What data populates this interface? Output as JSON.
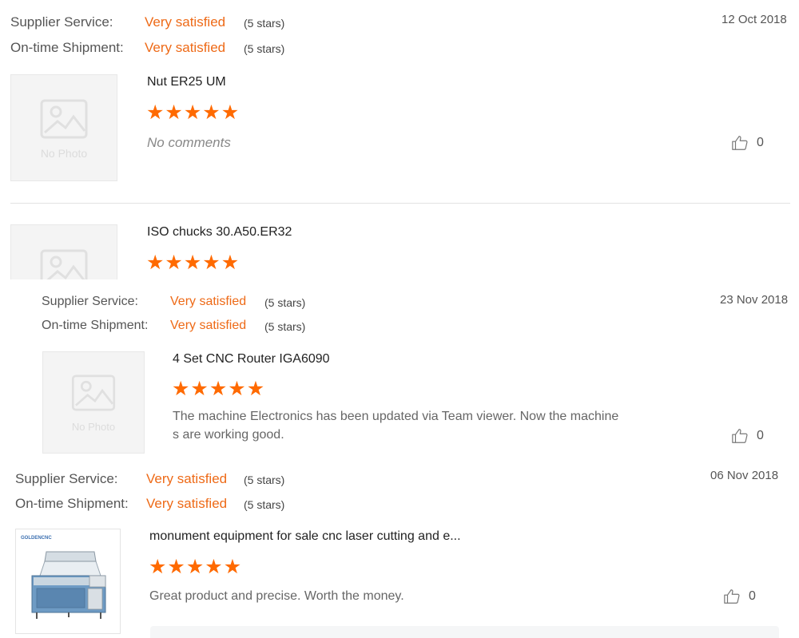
{
  "review1": {
    "supplier_label": "Supplier Service:",
    "supplier_value": "Very satisfied",
    "supplier_stars": "(5 stars)",
    "shipment_label": "On-time Shipment:",
    "shipment_value": "Very satisfied",
    "shipment_stars": "(5 stars)",
    "date": "12 Oct 2018",
    "product": "Nut ER25 UM",
    "rating": 5,
    "comment": "No comments",
    "likes": "0",
    "photo_text": "No Photo"
  },
  "review2": {
    "product": "ISO chucks 30.A50.ER32",
    "rating": 5
  },
  "review3": {
    "supplier_label": "Supplier Service:",
    "supplier_value": "Very satisfied",
    "supplier_stars": "(5 stars)",
    "shipment_label": "On-time Shipment:",
    "shipment_value": "Very satisfied",
    "shipment_stars": "(5 stars)",
    "date": "23 Nov 2018",
    "product": "4 Set CNC Router IGA6090",
    "rating": 5,
    "comment_line1": "The machine Electronics has been updated via Team viewer. Now the machine",
    "comment_line2": "s are working good.",
    "likes": "0",
    "photo_text": "No Photo"
  },
  "review4": {
    "supplier_label": "Supplier Service:",
    "supplier_value": "Very satisfied",
    "supplier_stars": "(5 stars)",
    "shipment_label": "On-time Shipment:",
    "shipment_value": "Very satisfied",
    "shipment_stars": "(5 stars)",
    "date": "06 Nov 2018",
    "product": "monument equipment for sale cnc laser cutting and e...",
    "rating": 5,
    "comment": "Great product and precise. Worth the money.",
    "likes": "0",
    "photo_logo": "GOLDENCNC"
  },
  "colors": {
    "accent": "#ee6a17",
    "star": "#ff6a00",
    "text": "#333333"
  },
  "icons": {
    "like": "thumbs-up-icon",
    "placeholder": "image-placeholder-icon",
    "star": "star-icon"
  }
}
